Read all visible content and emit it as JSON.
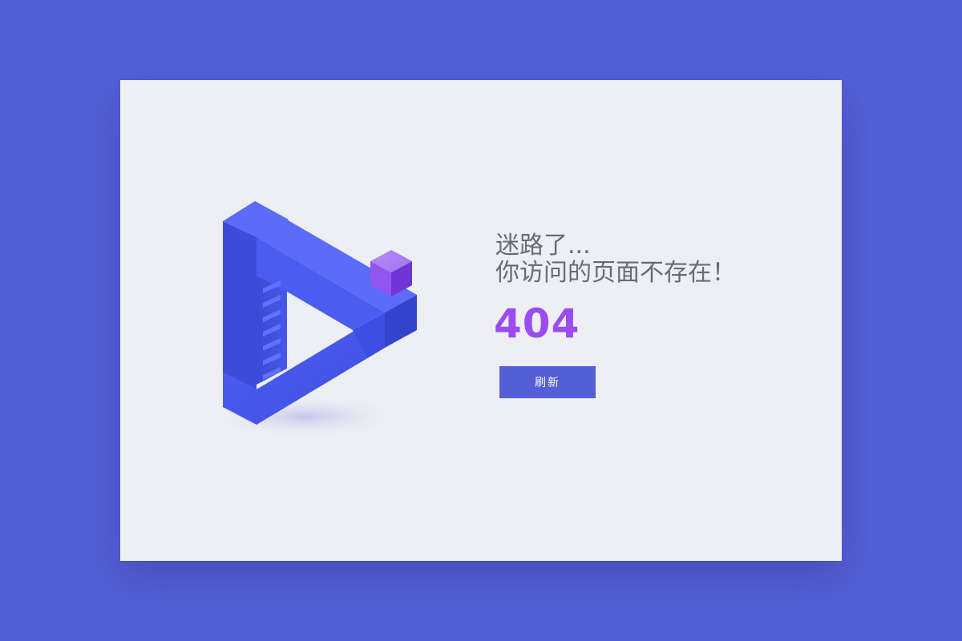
{
  "error_page": {
    "line1": "迷路了...",
    "line2": "你访问的页面不存在！",
    "code": "404",
    "refresh_label": "刷新",
    "illustration": "impossible-triangle-with-cube-icon"
  },
  "colors": {
    "background": "#5560d6",
    "card": "#eeeff4",
    "message_text": "#6a6a72",
    "code_text": "#9b4cf0",
    "button": "#545ed6",
    "triangle": "#4a5cf2",
    "cube": "#9a62f2"
  }
}
